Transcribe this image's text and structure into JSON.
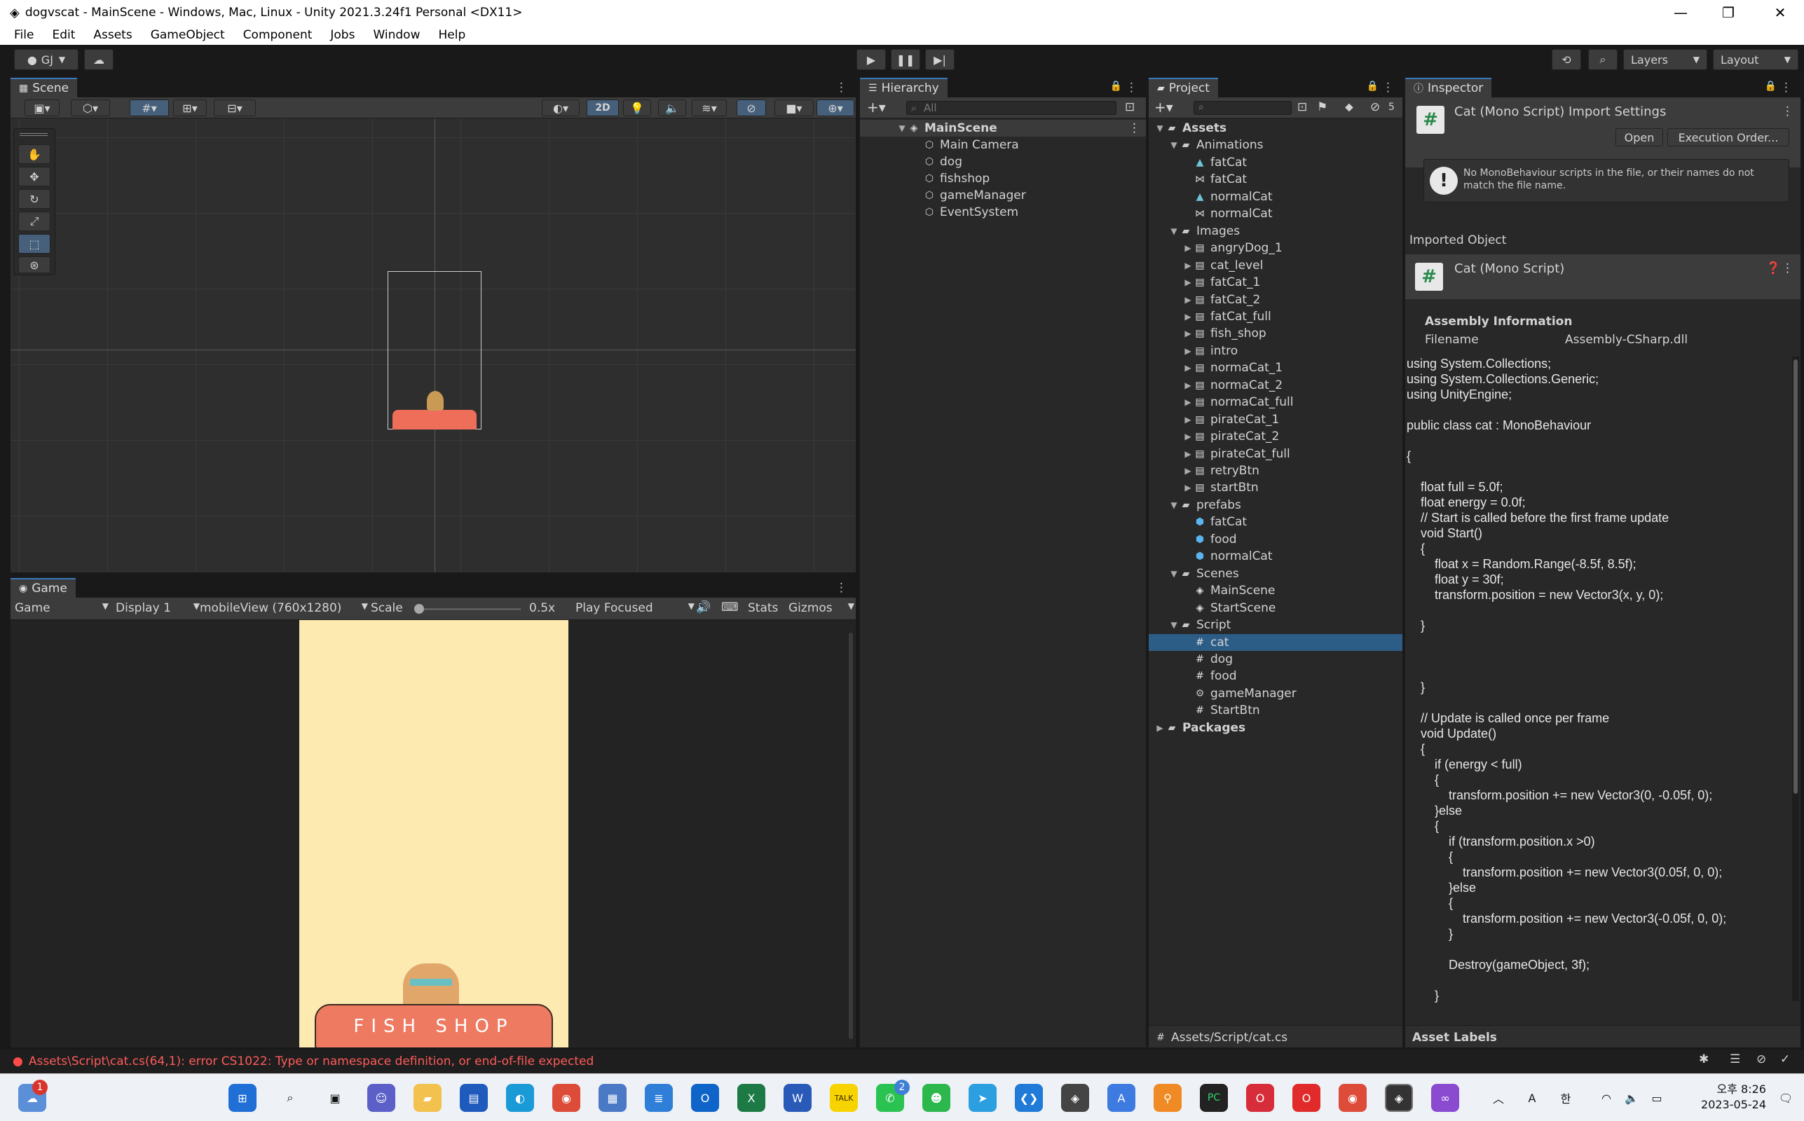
{
  "window": {
    "title": "dogvscat - MainScene - Windows, Mac, Linux - Unity 2021.3.24f1 Personal <DX11>",
    "minimize": "—",
    "maximize": "❐",
    "close": "✕"
  },
  "menu": [
    "File",
    "Edit",
    "Assets",
    "GameObject",
    "Component",
    "Jobs",
    "Window",
    "Help"
  ],
  "toolbar": {
    "account": "GJ",
    "layers": "Layers",
    "layout": "Layout"
  },
  "scene": {
    "tab": "Scene",
    "mode_2d": "2D"
  },
  "game": {
    "tab": "Game",
    "view": "Game",
    "display": "Display 1",
    "resolution": "mobileView (760x1280)",
    "scale_label": "Scale",
    "scale_value": "0.5x",
    "play_mode": "Play Focused",
    "stats": "Stats",
    "gizmos": "Gizmos",
    "shop_sign": "FISH SHOP"
  },
  "hierarchy": {
    "tab": "Hierarchy",
    "search_placeholder": "All",
    "root": "MainScene",
    "items": [
      "Main Camera",
      "dog",
      "fishshop",
      "gameManager",
      "EventSystem"
    ]
  },
  "project": {
    "tab": "Project",
    "badge": "5",
    "tree": [
      {
        "label": "Assets",
        "depth": 0,
        "type": "folder",
        "open": true,
        "bold": true
      },
      {
        "label": "Animations",
        "depth": 1,
        "type": "folder",
        "open": true
      },
      {
        "label": "fatCat",
        "depth": 2,
        "type": "anim"
      },
      {
        "label": "fatCat",
        "depth": 2,
        "type": "controller"
      },
      {
        "label": "normalCat",
        "depth": 2,
        "type": "anim"
      },
      {
        "label": "normalCat",
        "depth": 2,
        "type": "controller"
      },
      {
        "label": "Images",
        "depth": 1,
        "type": "folder",
        "open": true
      },
      {
        "label": "angryDog_1",
        "depth": 2,
        "type": "image",
        "closed": true
      },
      {
        "label": "cat_level",
        "depth": 2,
        "type": "image",
        "closed": true
      },
      {
        "label": "fatCat_1",
        "depth": 2,
        "type": "image",
        "closed": true
      },
      {
        "label": "fatCat_2",
        "depth": 2,
        "type": "image",
        "closed": true
      },
      {
        "label": "fatCat_full",
        "depth": 2,
        "type": "image",
        "closed": true
      },
      {
        "label": "fish_shop",
        "depth": 2,
        "type": "image",
        "closed": true
      },
      {
        "label": "intro",
        "depth": 2,
        "type": "image",
        "closed": true
      },
      {
        "label": "normaCat_1",
        "depth": 2,
        "type": "image",
        "closed": true
      },
      {
        "label": "normaCat_2",
        "depth": 2,
        "type": "image",
        "closed": true
      },
      {
        "label": "normaCat_full",
        "depth": 2,
        "type": "image",
        "closed": true
      },
      {
        "label": "pirateCat_1",
        "depth": 2,
        "type": "image",
        "closed": true
      },
      {
        "label": "pirateCat_2",
        "depth": 2,
        "type": "image",
        "closed": true
      },
      {
        "label": "pirateCat_full",
        "depth": 2,
        "type": "image",
        "closed": true
      },
      {
        "label": "retryBtn",
        "depth": 2,
        "type": "image",
        "closed": true
      },
      {
        "label": "startBtn",
        "depth": 2,
        "type": "image",
        "closed": true
      },
      {
        "label": "prefabs",
        "depth": 1,
        "type": "folder",
        "open": true
      },
      {
        "label": "fatCat",
        "depth": 2,
        "type": "prefab"
      },
      {
        "label": "food",
        "depth": 2,
        "type": "prefab"
      },
      {
        "label": "normalCat",
        "depth": 2,
        "type": "prefab"
      },
      {
        "label": "Scenes",
        "depth": 1,
        "type": "folder",
        "open": true
      },
      {
        "label": "MainScene",
        "depth": 2,
        "type": "scene"
      },
      {
        "label": "StartScene",
        "depth": 2,
        "type": "scene"
      },
      {
        "label": "Script",
        "depth": 1,
        "type": "folder",
        "open": true
      },
      {
        "label": "cat",
        "depth": 2,
        "type": "script",
        "selected": true
      },
      {
        "label": "dog",
        "depth": 2,
        "type": "script"
      },
      {
        "label": "food",
        "depth": 2,
        "type": "script"
      },
      {
        "label": "gameManager",
        "depth": 2,
        "type": "gear"
      },
      {
        "label": "StartBtn",
        "depth": 2,
        "type": "script"
      },
      {
        "label": "Packages",
        "depth": 0,
        "type": "folder",
        "closed": true,
        "bold": true
      }
    ],
    "footer_path": "Assets/Script/cat.cs"
  },
  "inspector": {
    "tab": "Inspector",
    "title": "Cat (Mono Script) Import Settings",
    "open_btn": "Open",
    "exec_btn": "Execution Order...",
    "warning": "No MonoBehaviour scripts in the file, or their names do not match the file name.",
    "imported_object": "Imported Object",
    "object_name": "Cat (Mono Script)",
    "assembly_header": "Assembly Information",
    "filename_label": "Filename",
    "filename_value": "Assembly-CSharp.dll",
    "code": "using System.Collections;\nusing System.Collections.Generic;\nusing UnityEngine;\n\npublic class cat : MonoBehaviour\n\n{\n\n    float full = 5.0f;\n    float energy = 0.0f;\n    // Start is called before the first frame update\n    void Start()\n    {\n        float x = Random.Range(-8.5f, 8.5f);\n        float y = 30f;\n        transform.position = new Vector3(x, y, 0);\n\n    }\n\n\n\n    }\n\n    // Update is called once per frame\n    void Update()\n    {\n        if (energy < full)\n        {\n            transform.position += new Vector3(0, -0.05f, 0);\n        }else\n        {\n            if (transform.position.x >0)\n            {\n                transform.position += new Vector3(0.05f, 0, 0);\n            }else\n            {\n                transform.position += new Vector3(-0.05f, 0, 0);\n            }\n\n            Destroy(gameObject, 3f);\n\n        }",
    "asset_labels": "Asset Labels"
  },
  "status": {
    "error": "Assets\\Script\\cat.cs(64,1): error CS1022: Type or namespace definition, or end-of-file expected"
  },
  "taskbar": {
    "notif_badge": "1",
    "whatsapp_badge": "2",
    "ime_a": "A",
    "ime_han": "한",
    "time": "오후 8:26",
    "date": "2023-05-24"
  }
}
